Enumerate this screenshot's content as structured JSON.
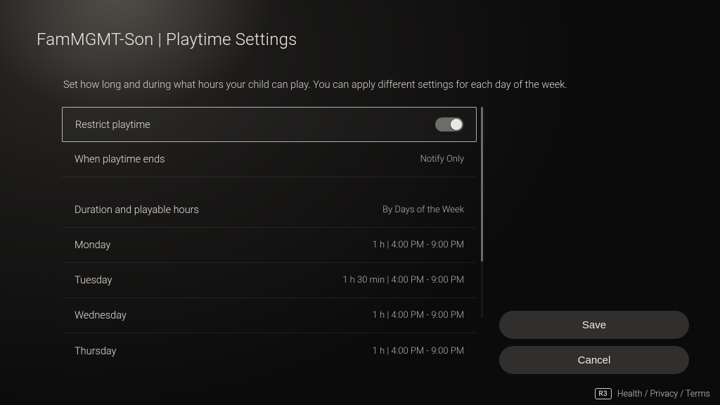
{
  "title": "FamMGMT-Son | Playtime Settings",
  "description": "Set how long and during what hours your child can play. You can apply different settings for each day of the week.",
  "rows": {
    "restrict": {
      "label": "Restrict playtime",
      "toggle_on": true
    },
    "ends": {
      "label": "When playtime ends",
      "value": "Notify Only"
    },
    "duration": {
      "label": "Duration and playable hours",
      "value": "By Days of the Week"
    },
    "monday": {
      "label": "Monday",
      "value": "1 h | 4:00 PM - 9:00 PM"
    },
    "tuesday": {
      "label": "Tuesday",
      "value": "1 h 30 min | 4:00 PM - 9:00 PM"
    },
    "wednesday": {
      "label": "Wednesday",
      "value": "1 h | 4:00 PM - 9:00 PM"
    },
    "thursday": {
      "label": "Thursday",
      "value": "1 h | 4:00 PM - 9:00 PM"
    }
  },
  "buttons": {
    "save": "Save",
    "cancel": "Cancel"
  },
  "footer": {
    "r3": "R3",
    "links": "Health / Privacy / Terms"
  }
}
